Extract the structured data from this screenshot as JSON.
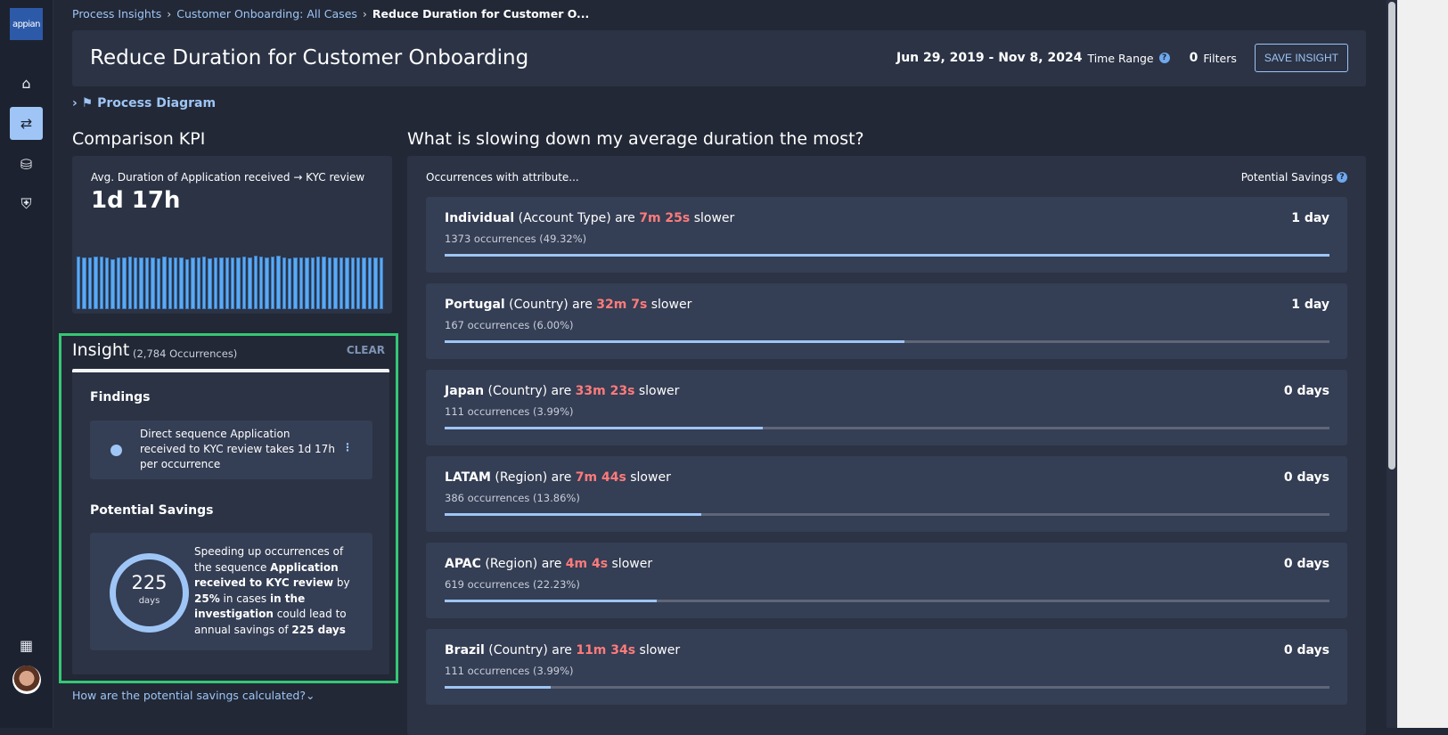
{
  "app": {
    "logo": "appian"
  },
  "sidebar": {
    "items": [
      {
        "icon": "home-icon"
      },
      {
        "icon": "process-icon",
        "active": true
      },
      {
        "icon": "database-icon"
      },
      {
        "icon": "shield-icon"
      }
    ],
    "apps_icon": "grid-icon"
  },
  "breadcrumb": [
    "Process Insights",
    "Customer Onboarding: All Cases",
    "Reduce Duration for Customer O..."
  ],
  "header": {
    "title": "Reduce Duration for Customer Onboarding",
    "date_range": "Jun 29, 2019 - Nov 8, 2024",
    "time_range_label": "Time Range",
    "filters_count": "0",
    "filters_label": "Filters",
    "save_label": "SAVE INSIGHT"
  },
  "process_diagram": "Process Diagram",
  "kpi": {
    "heading": "Comparison KPI",
    "label": "Avg. Duration of Application received → KYC review",
    "value": "1d 17h",
    "sparkline": [
      95,
      94,
      94,
      95,
      95,
      94,
      90,
      93,
      94,
      95,
      93,
      94,
      93,
      93,
      92,
      95,
      94,
      94,
      93,
      90,
      93,
      93,
      95,
      92,
      94,
      93,
      94,
      94,
      94,
      95,
      94,
      96,
      95,
      94,
      95,
      96,
      94,
      92,
      94,
      93,
      93,
      94,
      95,
      95,
      94,
      93,
      94,
      94,
      93,
      94,
      94,
      94,
      94,
      94
    ]
  },
  "insight": {
    "title": "Insight",
    "occurrences": "(2,784 Occurrences)",
    "clear_label": "CLEAR",
    "findings_heading": "Findings",
    "finding_text": "Direct sequence Application received to KYC review takes 1d 17h per occurrence",
    "savings_heading": "Potential Savings",
    "ring_value": "225",
    "ring_unit": "days",
    "savings_parts": [
      "Speeding up occurrences of the sequence ",
      "Application received to KYC review",
      " by ",
      "25%",
      " in cases ",
      "in the investigation",
      " could lead to annual savings of ",
      "225 days"
    ],
    "how_link": "How are the potential savings calculated?"
  },
  "slowdown": {
    "heading": "What is slowing down my average duration the most?",
    "col_left": "Occurrences with attribute...",
    "col_right": "Potential Savings",
    "rows": [
      {
        "name": "Individual",
        "attr": "(Account Type)",
        "are": "are",
        "delta": "7m 25s",
        "slower": "slower",
        "sub": "1373 occurrences (49.32%)",
        "savings": "1 day",
        "fill": 1.0
      },
      {
        "name": "Portugal",
        "attr": "(Country)",
        "are": "are",
        "delta": "32m 7s",
        "slower": "slower",
        "sub": "167 occurrences (6.00%)",
        "savings": "1 day",
        "fill": 0.52
      },
      {
        "name": "Japan",
        "attr": "(Country)",
        "are": "are",
        "delta": "33m 23s",
        "slower": "slower",
        "sub": "111 occurrences (3.99%)",
        "savings": "0 days",
        "fill": 0.36
      },
      {
        "name": "LATAM",
        "attr": "(Region)",
        "are": "are",
        "delta": "7m 44s",
        "slower": "slower",
        "sub": "386 occurrences (13.86%)",
        "savings": "0 days",
        "fill": 0.29
      },
      {
        "name": "APAC",
        "attr": "(Region)",
        "are": "are",
        "delta": "4m 4s",
        "slower": "slower",
        "sub": "619 occurrences (22.23%)",
        "savings": "0 days",
        "fill": 0.24
      },
      {
        "name": "Brazil",
        "attr": "(Country)",
        "are": "are",
        "delta": "11m 34s",
        "slower": "slower",
        "sub": "111 occurrences (3.99%)",
        "savings": "0 days",
        "fill": 0.12
      }
    ]
  },
  "colors": {
    "accent": "#9ec5f5",
    "slower": "#ff7b7b",
    "highlight_border": "#35c774",
    "background": "#222836",
    "card": "#2b3345"
  }
}
